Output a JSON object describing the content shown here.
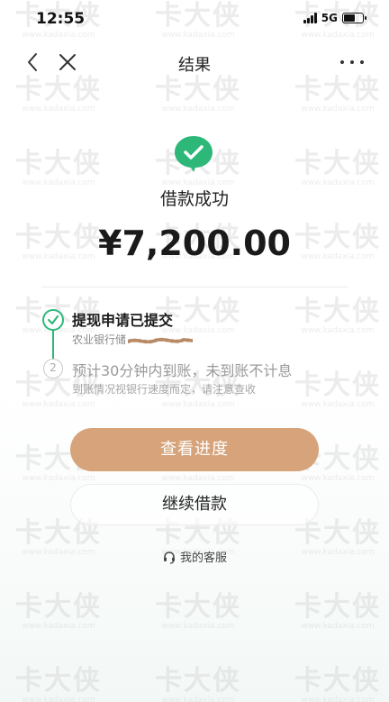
{
  "status_bar": {
    "time": "12:55",
    "network": "5G"
  },
  "nav": {
    "title": "结果",
    "back_icon": "chevron-left-icon",
    "close_icon": "close-icon",
    "more_icon": "more-dots-icon"
  },
  "result": {
    "title": "借款成功",
    "amount": "¥7,200.00",
    "accent_color": "#2db87a"
  },
  "steps": [
    {
      "number": "✓",
      "title": "提现申请已提交",
      "subtitle": "农业银行储"
    },
    {
      "number": "2",
      "title": "预计30分钟内到账，未到账不计息",
      "subtitle": "到账情况视银行速度而定，请注意查收"
    }
  ],
  "actions": {
    "primary_label": "查看进度",
    "primary_color": "#d6a37a",
    "secondary_label": "继续借款"
  },
  "service": {
    "label": "我的客服",
    "icon": "headset-icon"
  },
  "watermark": {
    "brand": "卡大侠",
    "site": "www.kadaxia.com"
  }
}
